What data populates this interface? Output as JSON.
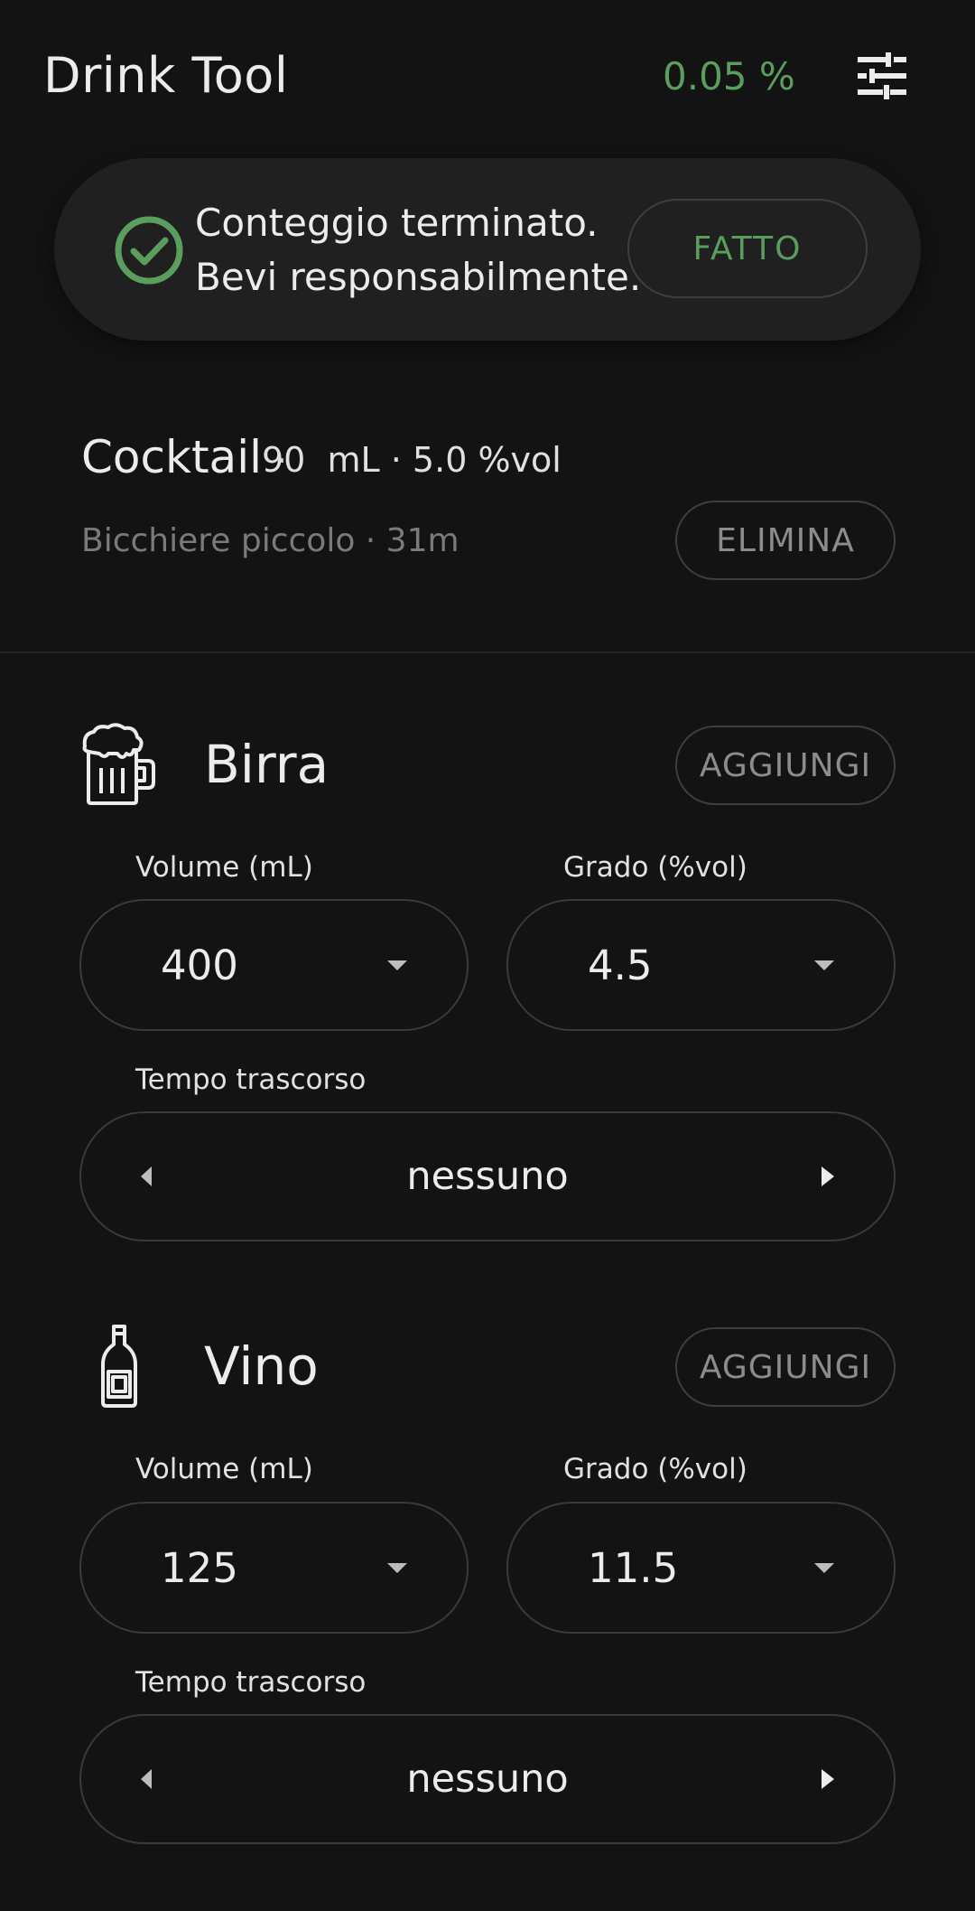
{
  "header": {
    "title": "Drink Tool",
    "bac_value": "0.05 %",
    "settings_icon": "sliders-icon"
  },
  "banner": {
    "icon": "check-circle-icon",
    "line1": "Conteggio terminato.",
    "line2": "Bevi responsabilmente.",
    "done_label": "FATTO"
  },
  "last_drink": {
    "name": "Cocktail",
    "separator": "·",
    "details": "90  mL · 5.0 %vol",
    "subtitle": "Bicchiere piccolo · 31m",
    "delete_label": "ELIMINA"
  },
  "sections": [
    {
      "icon": "beer-mug-icon",
      "title": "Birra",
      "add_label": "AGGIUNGI",
      "volume_label": "Volume (mL)",
      "volume_value": "400",
      "abv_label": "Grado (%vol)",
      "abv_value": "4.5",
      "time_label": "Tempo trascorso",
      "time_value": "nessuno"
    },
    {
      "icon": "wine-bottle-icon",
      "title": "Vino",
      "add_label": "AGGIUNGI",
      "volume_label": "Volume (mL)",
      "volume_value": "125",
      "abv_label": "Grado (%vol)",
      "abv_value": "11.5",
      "time_label": "Tempo trascorso",
      "time_value": "nessuno"
    }
  ],
  "colors": {
    "background": "#131313",
    "accent_green": "#5a9e5e",
    "banner_bg": "#202020",
    "outline": "#3a3a3a"
  }
}
